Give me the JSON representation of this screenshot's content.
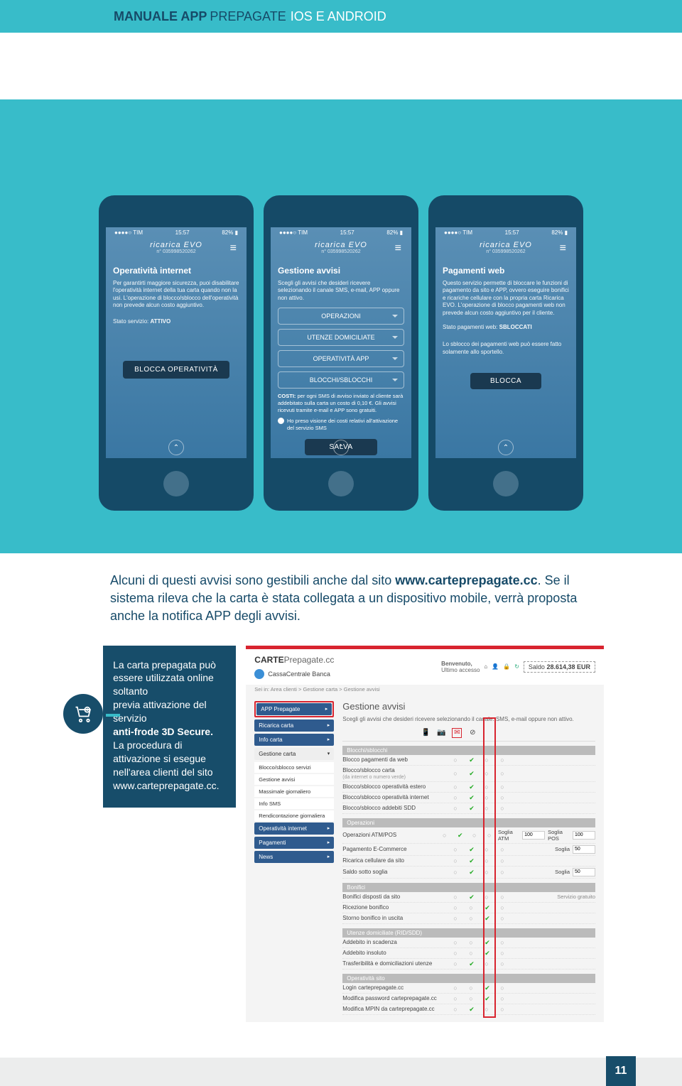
{
  "header": {
    "t1": "MANUALE APP",
    "t2": "PREPAGATE",
    "t3": "IOS E ANDROID"
  },
  "status": {
    "carrier": "●●●●○ TIM",
    "wifi": "⌃",
    "time": "15:57",
    "alarm": "⏰",
    "battery": "82% ▮"
  },
  "topbar": {
    "brand": "ricarica EVO",
    "sub": "n° 035998520262",
    "hamb": "≡"
  },
  "phone1": {
    "title": "Operatività internet",
    "text": "Per garantirti maggiore sicurezza, puoi disabilitare l'operatività internet della tua carta quando non la usi. L'operazione di blocco/sblocco dell'operatività non prevede alcun costo aggiuntivo.",
    "status_label": "Stato servizio:",
    "status_val": "ATTIVO",
    "btn": "BLOCCA OPERATIVITÀ"
  },
  "phone2": {
    "title": "Gestione avvisi",
    "text": "Scegli gli avvisi che desideri ricevere selezionando il canale SMS, e-mail, APP oppure non attivo.",
    "opts": [
      "OPERAZIONI",
      "UTENZE DOMICILIATE",
      "OPERATIVITÀ APP",
      "BLOCCHI/SBLOCCHI"
    ],
    "cost_lbl": "COSTI:",
    "cost_txt": "per ogni SMS di avviso inviato al cliente sarà addebitato sulla carta un costo di 0,10 €. Gli avvisi ricevuti tramite e-mail e APP sono gratuiti.",
    "ack": "Ho preso visione dei costi relativi all'attivazione del servizio SMS",
    "btn": "SALVA"
  },
  "phone3": {
    "title": "Pagamenti web",
    "text": "Questo servizio permette di bloccare le funzioni di pagamento da sito e APP, ovvero eseguire bonifici e ricariche cellulare con la propria carta Ricarica EVO. L'operazione di blocco pagamenti web non prevede alcun costo aggiuntivo per il cliente.",
    "status_label": "Stato pagamenti web:",
    "status_val": "SBLOCCATI",
    "note": "Lo sblocco dei pagamenti web può essere fatto solamente allo sportello.",
    "btn": "BLOCCA"
  },
  "lead": {
    "p1a": "Alcuni di questi avvisi sono gestibili anche dal sito ",
    "url": "www.carteprepagate.cc",
    "p1b": ". Se il sistema rileva che la carta è stata collegata a un dispositivo mobile, verrà proposta anche la notifica APP degli avvisi."
  },
  "box": {
    "l1": "La carta prepagata può essere utilizzata online soltanto",
    "l2": "previa attivazione del servizio",
    "l3": "anti-frode 3D Secure.",
    "l4": "La procedura di attivazione si esegue nell'area clienti del sito www.carteprepagate.cc."
  },
  "web": {
    "logo1": "CARTE",
    "logo2": "Prepagate.cc",
    "ccb": "CassaCentrale Banca",
    "welcome": "Benvenuto,",
    "last": "Ultimo accesso",
    "saldo_lbl": "Saldo",
    "saldo_val": "28.614,38 EUR",
    "bc": "Sei in: Area clienti > Gestione carta > Gestione avvisi",
    "nav": {
      "app": "APP Prepagate",
      "ric": "Ricarica carta",
      "info": "Info carta",
      "gest": "Gestione carta",
      "sub": [
        "Blocco/sblocco servizi",
        "Gestione avvisi",
        "Massimale giornaliero",
        "Info SMS",
        "Rendicontazione giornaliera"
      ],
      "op": "Operatività internet",
      "pag": "Pagamenti",
      "news": "News"
    },
    "main": {
      "title": "Gestione avvisi",
      "desc": "Scegli gli avvisi che desideri ricevere selezionando il canale: SMS, e-mail oppure non attivo.",
      "sects": {
        "s1": "Blocchi/sblocchi",
        "s2": "Operazioni",
        "s3": "Bonifici",
        "s4": "Utenze domiciliate (RID/SDD)",
        "s5": "Operatività sito"
      },
      "rows": {
        "r1": "Blocco pagamenti da web",
        "r2": "Blocco/sblocco carta",
        "r2s": "(da internet o numero verde)",
        "r3": "Blocco/sblocco operatività estero",
        "r4": "Blocco/sblocco operatività internet",
        "r5": "Blocco/sblocco addebiti SDD",
        "r6": "Operazioni ATM/POS",
        "r7": "Pagamento E-Commerce",
        "r8": "Ricarica cellulare da sito",
        "r9": "Saldo sotto soglia",
        "r10": "Bonifici disposti da sito",
        "r11": "Ricezione bonifico",
        "r12": "Storno bonifico in uscita",
        "r13": "Addebito in scadenza",
        "r14": "Addebito insoluto",
        "r15": "Trasferibilità e domiciliazioni utenze",
        "r16": "Login carteprepagate.cc",
        "r17": "Modifica password carteprepagate.cc",
        "r18": "Modifica MPIN da carteprepagate.cc",
        "soglia": "Soglia",
        "sogliaATM": "Soglia ATM",
        "sogliaPOS": "Soglia POS",
        "v50": "50",
        "v100": "100",
        "servgr": "Servizio gratuito"
      }
    }
  },
  "page": "11"
}
